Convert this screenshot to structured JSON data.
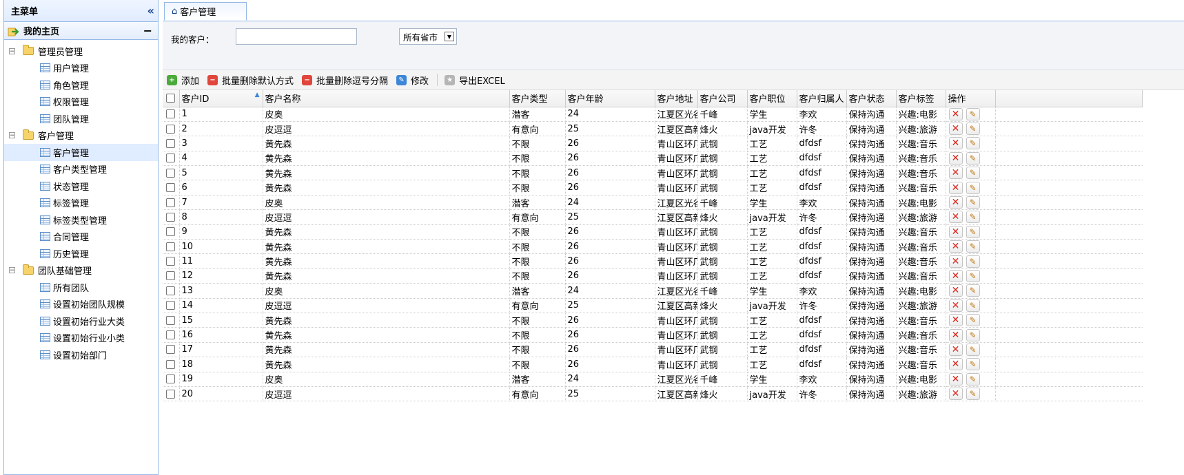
{
  "sidebar": {
    "title": "主菜单",
    "home_label": "我的主页",
    "groups": [
      {
        "label": "管理员管理",
        "items": [
          "用户管理",
          "角色管理",
          "权限管理",
          "团队管理"
        ]
      },
      {
        "label": "客户管理",
        "items": [
          "客户管理",
          "客户类型管理",
          "状态管理",
          "标签管理",
          "标签类型管理",
          "合同管理",
          "历史管理"
        ]
      },
      {
        "label": "团队基础管理",
        "items": [
          "所有团队",
          "设置初始团队规模",
          "设置初始行业大类",
          "设置初始行业小类",
          "设置初始部门"
        ]
      }
    ],
    "selected_item": "客户管理"
  },
  "tab": {
    "label": "客户管理"
  },
  "filter": {
    "customer_label": "我的客户：",
    "customer_value": "",
    "province_select": "所有省市"
  },
  "toolbar": {
    "add": "添加",
    "batch_delete_default": "批量删除默认方式",
    "batch_delete_comma": "批量删除逗号分隔",
    "edit": "修改",
    "export": "导出EXCEL"
  },
  "table": {
    "headers": [
      "客户ID",
      "客户名称",
      "客户类型",
      "客户年龄",
      "客户地址",
      "客户公司",
      "客户职位",
      "客户归属人",
      "客户状态",
      "客户标签",
      "操作"
    ],
    "rows": [
      [
        "1",
        "皮奥",
        "潜客",
        "24",
        "江夏区光谷",
        "千峰",
        "学生",
        "李欢",
        "保持沟通",
        "兴趣:电影"
      ],
      [
        "2",
        "皮逗逗",
        "有意向",
        "25",
        "江夏区高新",
        "烽火",
        "java开发",
        "许冬",
        "保持沟通",
        "兴趣:旅游"
      ],
      [
        "3",
        "黄先森",
        "不限",
        "26",
        "青山区环厂",
        "武钢",
        "工艺",
        "dfdsf",
        "保持沟通",
        "兴趣:音乐"
      ],
      [
        "4",
        "黄先森",
        "不限",
        "26",
        "青山区环厂",
        "武钢",
        "工艺",
        "dfdsf",
        "保持沟通",
        "兴趣:音乐"
      ],
      [
        "5",
        "黄先森",
        "不限",
        "26",
        "青山区环厂",
        "武钢",
        "工艺",
        "dfdsf",
        "保持沟通",
        "兴趣:音乐"
      ],
      [
        "6",
        "黄先森",
        "不限",
        "26",
        "青山区环厂",
        "武钢",
        "工艺",
        "dfdsf",
        "保持沟通",
        "兴趣:音乐"
      ],
      [
        "7",
        "皮奥",
        "潜客",
        "24",
        "江夏区光谷",
        "千峰",
        "学生",
        "李欢",
        "保持沟通",
        "兴趣:电影"
      ],
      [
        "8",
        "皮逗逗",
        "有意向",
        "25",
        "江夏区高新",
        "烽火",
        "java开发",
        "许冬",
        "保持沟通",
        "兴趣:旅游"
      ],
      [
        "9",
        "黄先森",
        "不限",
        "26",
        "青山区环厂",
        "武钢",
        "工艺",
        "dfdsf",
        "保持沟通",
        "兴趣:音乐"
      ],
      [
        "10",
        "黄先森",
        "不限",
        "26",
        "青山区环厂",
        "武钢",
        "工艺",
        "dfdsf",
        "保持沟通",
        "兴趣:音乐"
      ],
      [
        "11",
        "黄先森",
        "不限",
        "26",
        "青山区环厂",
        "武钢",
        "工艺",
        "dfdsf",
        "保持沟通",
        "兴趣:音乐"
      ],
      [
        "12",
        "黄先森",
        "不限",
        "26",
        "青山区环厂",
        "武钢",
        "工艺",
        "dfdsf",
        "保持沟通",
        "兴趣:音乐"
      ],
      [
        "13",
        "皮奥",
        "潜客",
        "24",
        "江夏区光谷",
        "千峰",
        "学生",
        "李欢",
        "保持沟通",
        "兴趣:电影"
      ],
      [
        "14",
        "皮逗逗",
        "有意向",
        "25",
        "江夏区高新",
        "烽火",
        "java开发",
        "许冬",
        "保持沟通",
        "兴趣:旅游"
      ],
      [
        "15",
        "黄先森",
        "不限",
        "26",
        "青山区环厂",
        "武钢",
        "工艺",
        "dfdsf",
        "保持沟通",
        "兴趣:音乐"
      ],
      [
        "16",
        "黄先森",
        "不限",
        "26",
        "青山区环厂",
        "武钢",
        "工艺",
        "dfdsf",
        "保持沟通",
        "兴趣:音乐"
      ],
      [
        "17",
        "黄先森",
        "不限",
        "26",
        "青山区环厂",
        "武钢",
        "工艺",
        "dfdsf",
        "保持沟通",
        "兴趣:音乐"
      ],
      [
        "18",
        "黄先森",
        "不限",
        "26",
        "青山区环厂",
        "武钢",
        "工艺",
        "dfdsf",
        "保持沟通",
        "兴趣:音乐"
      ],
      [
        "19",
        "皮奥",
        "潜客",
        "24",
        "江夏区光谷",
        "千峰",
        "学生",
        "李欢",
        "保持沟通",
        "兴趣:电影"
      ],
      [
        "20",
        "皮逗逗",
        "有意向",
        "25",
        "江夏区高新",
        "烽火",
        "java开发",
        "许冬",
        "保持沟通",
        "兴趣:旅游"
      ]
    ]
  },
  "icons": {
    "collapse": "double-chevron-left-icon",
    "home": "home-icon",
    "folder": "folder-icon",
    "page": "table-page-icon",
    "delete": "delete-x-icon",
    "edit": "pencil-edit-icon"
  },
  "colors": {
    "border_blue": "#95b8e7",
    "header_bg": "#e0ecff",
    "delete_red": "#e0241c"
  }
}
